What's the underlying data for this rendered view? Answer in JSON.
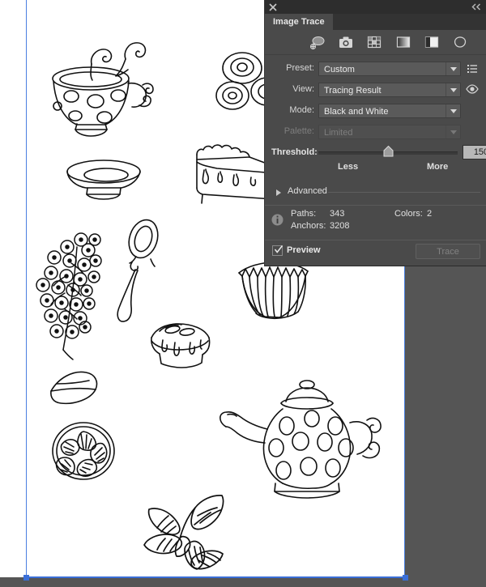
{
  "panel": {
    "title": "Image Trace",
    "close_icon": "close-icon",
    "collapse_icon": "double-chevron-left-icon",
    "preset_icons": [
      "auto-color-icon",
      "high-color-photo-icon",
      "low-color-icon",
      "grayscale-icon",
      "black-and-white-icon",
      "outline-icon"
    ],
    "fields": {
      "preset": {
        "label": "Preset:",
        "value": "Custom",
        "menu_icon": "preset-menu-icon",
        "disabled": false
      },
      "view": {
        "label": "View:",
        "value": "Tracing Result",
        "eye_icon": "eye-icon",
        "disabled": false
      },
      "mode": {
        "label": "Mode:",
        "value": "Black and White",
        "disabled": false
      },
      "palette": {
        "label": "Palette:",
        "value": "Limited",
        "disabled": true
      }
    },
    "threshold": {
      "label": "Threshold:",
      "value": "150",
      "less_label": "Less",
      "more_label": "More",
      "percent": 45
    },
    "advanced": {
      "label": "Advanced",
      "expanded": false
    },
    "info": {
      "icon": "info-icon",
      "paths_label": "Paths:",
      "paths_value": "343",
      "anchors_label": "Anchors:",
      "anchors_value": "3208",
      "colors_label": "Colors:",
      "colors_value": "2"
    },
    "footer": {
      "preview_label": "Preview",
      "preview_checked": true,
      "trace_label": "Trace",
      "trace_enabled": false
    },
    "colors": {
      "panel_bg": "#4a4a4a",
      "titlebar_bg": "#2d2d2d",
      "text": "#d4d4d4",
      "disabled_text": "#7e7e7e",
      "field_bg": "#5a5a5a"
    }
  },
  "canvas": {
    "background": "#555555",
    "artboard_fill": "#ffffff",
    "artboard_border": "#4a7fe0",
    "selection_color": "#3a6fd8",
    "artwork_description": "Hand-drawn black and white line art of tea and bakery items",
    "artwork_items": [
      "polka-dot-teacup-with-steam",
      "saucer",
      "macaron-cookies",
      "pie-slice-with-glaze",
      "currant-berry-cluster",
      "spoon",
      "cupcake-liner",
      "glazed-tart",
      "leaf",
      "citrus-slice",
      "polka-dot-teapot",
      "mint-leaf-sprig"
    ]
  }
}
